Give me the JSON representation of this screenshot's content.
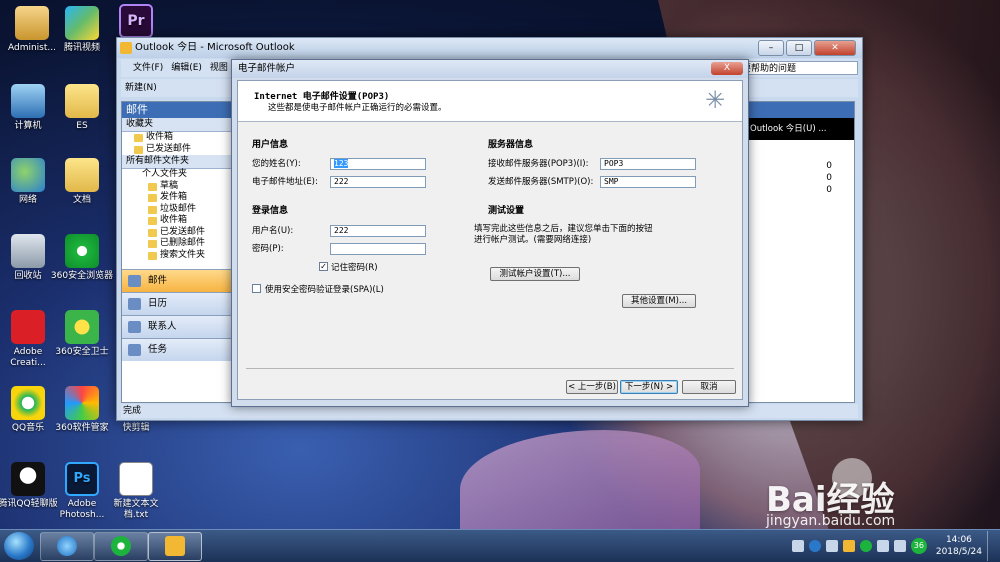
{
  "desktop": {
    "icons": [
      {
        "label": "Administ...",
        "icon": "user-folder-icon"
      },
      {
        "label": "腾讯视频",
        "icon": "tencent-video-icon"
      },
      {
        "label": "",
        "icon": "premiere-icon",
        "glyph": "Pr"
      },
      {
        "label": "计算机",
        "icon": "computer-icon"
      },
      {
        "label": "ES",
        "icon": "folder-icon"
      },
      {
        "label": "网络",
        "icon": "network-icon"
      },
      {
        "label": "文档",
        "icon": "folder-icon"
      },
      {
        "label": "回收站",
        "icon": "recycle-bin-icon"
      },
      {
        "label": "360安全浏览器",
        "icon": "360-browser-icon"
      },
      {
        "label": "Adobe Creati...",
        "icon": "adobe-cc-icon"
      },
      {
        "label": "360安全卫士",
        "icon": "360-guard-icon"
      },
      {
        "label": "QQ音乐",
        "icon": "qq-music-icon"
      },
      {
        "label": "360软件管家",
        "icon": "360-software-icon"
      },
      {
        "label": "快剪辑",
        "icon": "clip-icon"
      },
      {
        "label": "腾讯QQ轻聊版",
        "icon": "qq-icon"
      },
      {
        "label": "Adobe Photosh...",
        "icon": "photoshop-icon",
        "glyph": "Ps"
      },
      {
        "label": "新建文本文档.txt",
        "icon": "text-file-icon"
      }
    ]
  },
  "outlook": {
    "title": "Outlook 今日 - Microsoft Outlook",
    "menu": [
      "文件(F)",
      "编辑(E)",
      "视图"
    ],
    "help_placeholder": "要帮助的问题",
    "toolbar_new": "新建(N)",
    "nav": {
      "header": "邮件",
      "favorites_label": "收藏夹",
      "favorites": [
        "收件箱",
        "已发送邮件"
      ],
      "all_label": "所有邮件文件夹",
      "root": "个人文件夹",
      "folders": [
        "草稿",
        "发件箱",
        "垃圾邮件",
        "收件箱",
        "已发送邮件",
        "已删除邮件",
        "搜索文件夹"
      ],
      "buttons": [
        "邮件",
        "日历",
        "联系人",
        "任务"
      ]
    },
    "right_pane": {
      "header": "Outlook 今日(U) ...",
      "counts": [
        "0",
        "0",
        "0"
      ]
    },
    "status": "完成"
  },
  "dialog": {
    "title": "电子邮件帐户",
    "close_label": "X",
    "header_title": "Internet 电子邮件设置(POP3)",
    "header_sub": "这些都是使电子邮件帐户正确运行的必需设置。",
    "user_info": "用户信息",
    "name_label": "您的姓名(Y):",
    "name_value": "123",
    "email_label": "电子邮件地址(E):",
    "email_value": "222",
    "login_info": "登录信息",
    "username_label": "用户名(U):",
    "username_value": "222",
    "password_label": "密码(P):",
    "password_value": "",
    "remember_label": "记住密码(R)",
    "remember_checked": true,
    "spa_label": "使用安全密码验证登录(SPA)(L)",
    "spa_checked": false,
    "server_info": "服务器信息",
    "pop3_label": "接收邮件服务器(POP3)(I):",
    "pop3_value": "POP3",
    "smtp_label": "发送邮件服务器(SMTP)(O):",
    "smtp_value": "SMP",
    "test_title": "测试设置",
    "test_desc_1": "填写完此这些信息之后，建议您单击下面的按钮",
    "test_desc_2": "进行帐户测试。(需要网络连接)",
    "test_button": "测试帐户设置(T)...",
    "more_button": "其他设置(M)...",
    "back_button": "< 上一步(B)",
    "next_button": "下一步(N) >",
    "cancel_button": "取消"
  },
  "taskbar": {
    "clock_time": "14:06",
    "clock_date": "2018/5/24",
    "tray_badge": "36"
  },
  "watermark": {
    "brand": "Bai经验",
    "url": "jingyan.baidu.com"
  }
}
